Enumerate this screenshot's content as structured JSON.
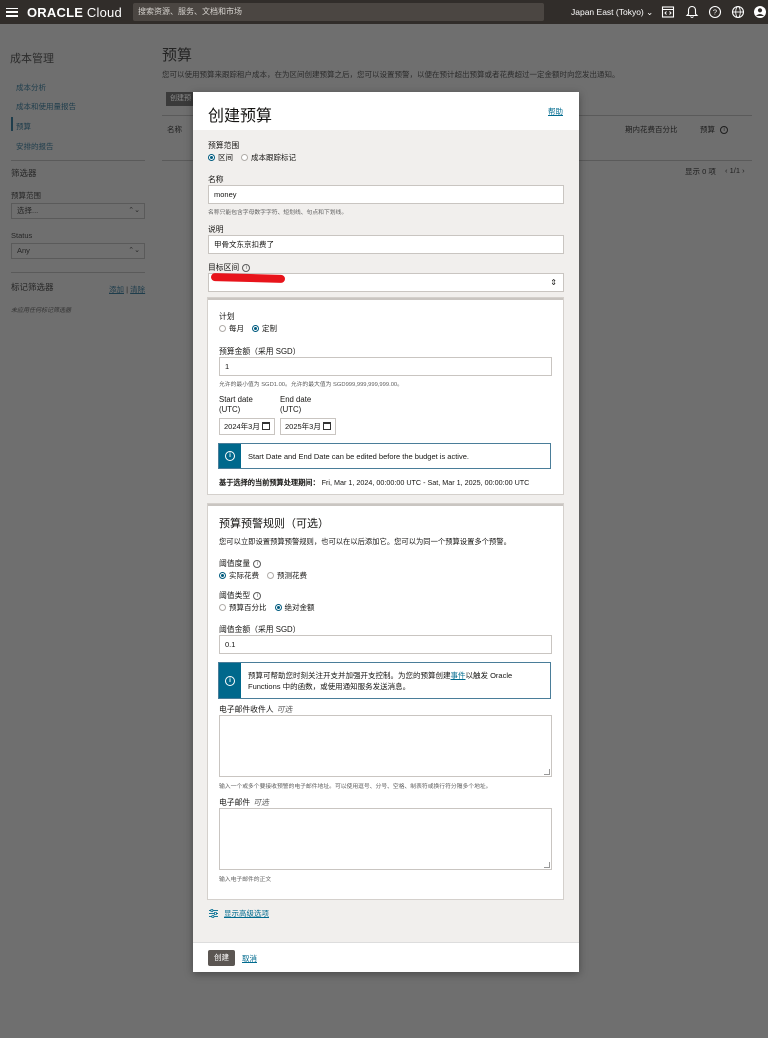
{
  "topbar": {
    "brand_prefix": "ORACLE",
    "brand_suffix": " Cloud",
    "search_placeholder": "搜索资源、服务、文档和市场",
    "region": "Japan East (Tokyo)"
  },
  "sidebar": {
    "title": "成本管理",
    "items": [
      {
        "label": "成本分析"
      },
      {
        "label": "成本和使用量报告"
      },
      {
        "label": "预算"
      },
      {
        "label": "安排的报告"
      }
    ],
    "filters_title": "筛选器",
    "scope_label": "预算范围",
    "scope_value": "选择...",
    "status_label": "Status",
    "status_value": "Any",
    "tag_filters_label": "标记筛选器",
    "tag_add": "添加",
    "tag_sep": "|",
    "tag_clear": "清除",
    "tag_hint": "未应用任何标记筛选器"
  },
  "main": {
    "title": "预算",
    "description": "您可以使用预算来跟踪租户成本，在为区间创建预算之后，您可以设置预警，以便在预计超出预算或者花费超过一定金额时向您发出通知。",
    "create_button": "创建预",
    "table_headers": {
      "name": "名称",
      "percent": "期内花费百分比",
      "budget": "预算"
    },
    "footer_showing": "显示 0 项",
    "footer_pages": "1/1"
  },
  "modal": {
    "title": "创建预算",
    "help_link": "帮助",
    "scope_label": "预算范围",
    "scope_options": [
      {
        "label": "区间",
        "selected": true
      },
      {
        "label": "成本跟踪标记",
        "selected": false
      }
    ],
    "name_label": "名称",
    "name_value": "money",
    "name_hint": "名称只能包含字母数字字符、短划线、句点和下划线。",
    "desc_label": "说明",
    "desc_value": "甲骨文东京扣费了",
    "target_label": "目标区间",
    "plan_label": "计划",
    "plan_options": [
      {
        "label": "每月",
        "selected": false
      },
      {
        "label": "定制",
        "selected": true
      }
    ],
    "amount_label": "预算金额（采用 SGD）",
    "amount_value": "1",
    "amount_hint": "允许的最小值为 SGD1.00。允许的最大值为 SGD999,999,999,999.00。",
    "start_label_1": "Start date",
    "start_label_2": "(UTC)",
    "end_label_1": "End date",
    "end_label_2": "(UTC)",
    "start_value": "2024年3月",
    "end_value": "2025年3月",
    "date_info": "Start Date and End Date can be edited before the budget is active.",
    "period_label": "基于选择的当前预算处理期间：",
    "period_value": "Fri, Mar 1, 2024, 00:00:00 UTC - Sat, Mar 1, 2025, 00:00:00 UTC",
    "alert_title": "预算预警规则（可选）",
    "alert_desc": "您可以立即设置预算预警规则，也可以在以后添加它。您可以为同一个预算设置多个预警。",
    "threshold_metric_label": "阈值度量",
    "metric_options": [
      {
        "label": "实际花费",
        "selected": true
      },
      {
        "label": "预测花费",
        "selected": false
      }
    ],
    "threshold_type_label": "阈值类型",
    "type_options": [
      {
        "label": "预算百分比",
        "selected": false
      },
      {
        "label": "绝对金额",
        "selected": true
      }
    ],
    "threshold_amount_label": "阈值金额（采用 SGD）",
    "threshold_amount_value": "0.1",
    "events_info_1_pre": "预算可帮助您时刻关注开支并加强开支控制。为您的预算创建",
    "events_info_1_link": "事件",
    "events_info_1_post": "以触发 Oracle",
    "events_info_2": "Functions 中的函数，或使用通知服务发送消息。",
    "email_recipients_label": "电子邮件收件人",
    "optional": "可选",
    "email_recipients_hint": "输入一个或多个要接收预警的电子邮件地址。可以使用逗号、分号、空格、制表符或换行符分隔多个地址。",
    "email_message_label": "电子邮件",
    "email_message_hint": "输入电子邮件的正文",
    "advanced_link": "显示高级选项",
    "create_button": "创建",
    "cancel_link": "取消"
  }
}
